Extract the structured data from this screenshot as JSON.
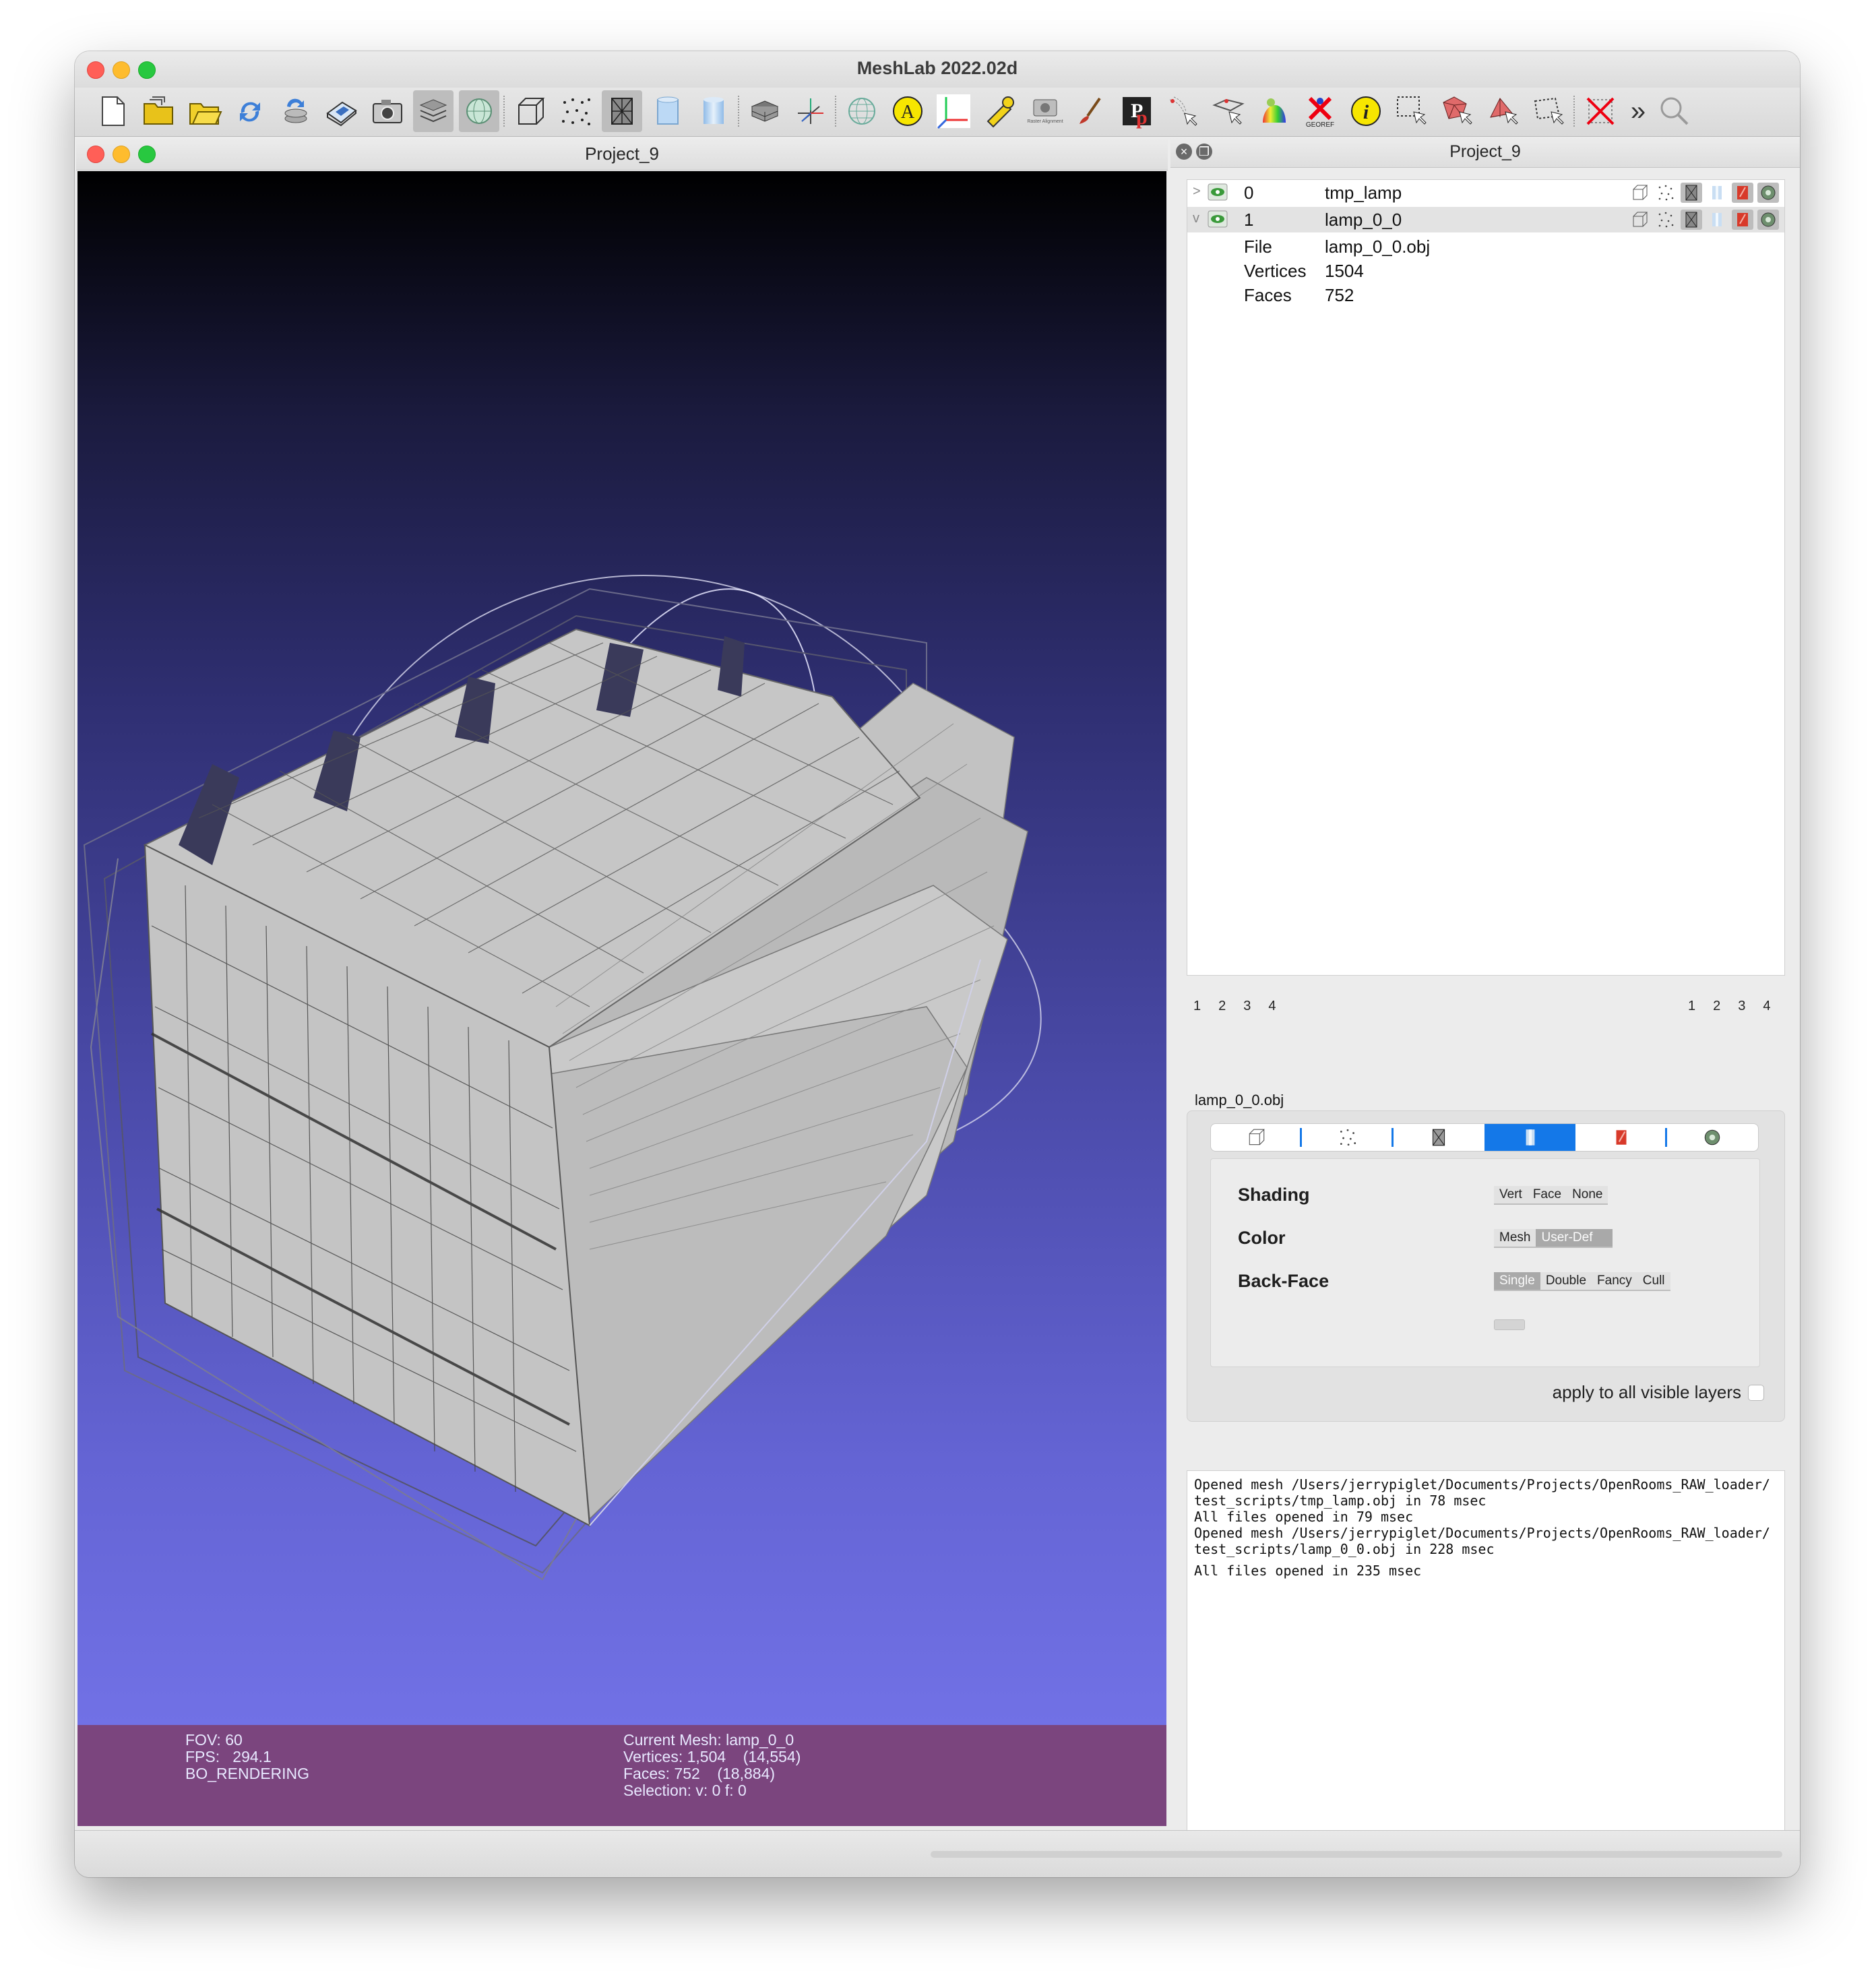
{
  "app": {
    "title": "MeshLab 2022.02d"
  },
  "toolbar": {
    "icons": [
      "new-project-icon",
      "open-project-icon",
      "import-mesh-icon",
      "reload-icon",
      "reload-all-icon",
      "save-icon",
      "snapshot-icon",
      "layers-icon",
      "globe-icon",
      "bbox-icon",
      "points-icon",
      "wireframe-icon",
      "flat-icon",
      "smooth-icon",
      "trackball-icon",
      "axes-icon",
      "sphere-icon",
      "annotation-icon",
      "axis-icon",
      "measure-icon",
      "raster-icon",
      "paint-icon",
      "pickpoints-icon",
      "align-icon",
      "manipulate-icon",
      "color-icon",
      "georef-icon",
      "info-icon",
      "select-vertices-icon",
      "select-faces-icon",
      "select-connected-icon",
      "select-region-icon",
      "delete-icon",
      "more-icon",
      "search-icon"
    ],
    "raster_label": "Raster Alignment",
    "georef_label": "GEOREF",
    "more_label": "»"
  },
  "viewport": {
    "title": "Project_9",
    "info_left": [
      "FOV: 60",
      "FPS:   294.1",
      "BO_RENDERING"
    ],
    "info_right": [
      "Current Mesh: lamp_0_0",
      "Vertices: 1,504    (14,554)",
      "Faces: 752    (18,884)",
      "Selection: v: 0 f: 0"
    ]
  },
  "panel": {
    "title": "Project_9",
    "layers": [
      {
        "index": "0",
        "name": "tmp_lamp",
        "expanded": false
      },
      {
        "index": "1",
        "name": "lamp_0_0",
        "expanded": true
      }
    ],
    "details": [
      {
        "key": "File",
        "value": "lamp_0_0.obj"
      },
      {
        "key": "Vertices",
        "value": "1504"
      },
      {
        "key": "Faces",
        "value": "752"
      }
    ],
    "pages_left": [
      "1",
      "2",
      "3",
      "4"
    ],
    "pages_right": [
      "1",
      "2",
      "3",
      "4"
    ],
    "decorator": {
      "file_label": "lamp_0_0.obj",
      "shading_label": "Shading",
      "shading_options": [
        "Vert",
        "Face",
        "None"
      ],
      "color_label": "Color",
      "color_options": [
        "Mesh",
        "User-Def"
      ],
      "color_selected": "User-Def",
      "backface_label": "Back-Face",
      "backface_options": [
        "Single",
        "Double",
        "Fancy",
        "Cull"
      ],
      "backface_selected": "Single",
      "apply_label": "apply to all visible layers"
    },
    "log": [
      "Opened mesh /Users/jerrypiglet/Documents/Projects/OpenRooms_RAW_loader/",
      "test_scripts/tmp_lamp.obj in 78 msec",
      "All files opened in 79 msec",
      "Opened mesh /Users/jerrypiglet/Documents/Projects/OpenRooms_RAW_loader/",
      "test_scripts/lamp_0_0.obj in 228 msec",
      "All files opened in 235 msec"
    ]
  },
  "colors": {
    "accent": "#1478e8",
    "info_bar": "#7b457e",
    "mesh_fill": "#c6c6c6",
    "bg_top": "#000000",
    "bg_bottom": "#7676ec"
  }
}
